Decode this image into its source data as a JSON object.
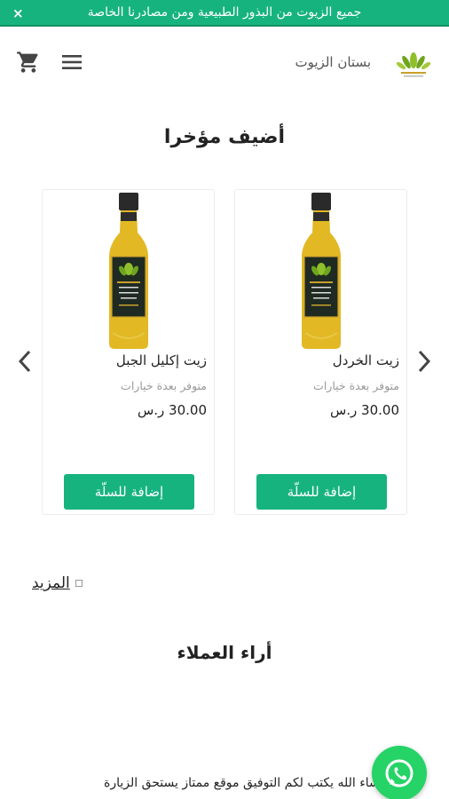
{
  "announcement": {
    "text": "جميع الزيوت من البذور الطبيعية ومن مصادرنا الخاصة",
    "close_label": "×"
  },
  "header": {
    "store_name": "بستان الزيوت",
    "logo_icon": "olive-plant-logo",
    "menu_icon": "hamburger-menu-icon",
    "cart_icon": "shopping-cart-icon"
  },
  "recent": {
    "title": "أضيف مؤخرا",
    "products": [
      {
        "name": "زيت الخردل",
        "availability": "متوفر بعدة خيارات",
        "price": "30.00 ر.س",
        "button_label": "إضافة للسلّة"
      },
      {
        "name": "زيت إكليل الجبل",
        "availability": "متوفر بعدة خيارات",
        "price": "30.00 ر.س",
        "button_label": "إضافة للسلّة"
      }
    ],
    "more_label": "المزيد"
  },
  "reviews": {
    "title": "أراء العملاء",
    "review_text": "ما شاء الله يكتب لكم التوفيق موقع ممتاز يستحق الزيارة"
  },
  "colors": {
    "accent": "#16b37f",
    "whatsapp": "#25d366",
    "oil": "#e2b824"
  }
}
